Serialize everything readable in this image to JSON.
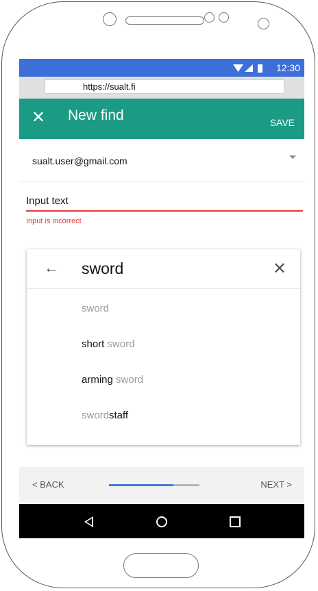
{
  "status_bar": {
    "time": "12:30",
    "icons": [
      "wifi-icon",
      "signal-icon",
      "battery-icon"
    ],
    "color": "#3d6fd9"
  },
  "browser": {
    "url": "https://sualt.fi"
  },
  "app_bar": {
    "title": "New find",
    "close_icon": "close-icon",
    "save_label": "SAVE",
    "color": "#1b9a84"
  },
  "account": {
    "email": "sualt.user@gmail.com",
    "dropdown_icon": "caret-down-icon"
  },
  "input": {
    "label": "Input text",
    "error": "Input is incorrect",
    "error_color": "#e53935"
  },
  "search": {
    "query": "sword",
    "back_icon": "arrow-left-icon",
    "clear_icon": "close-icon",
    "suggestions": [
      {
        "bold": "",
        "muted": "sword"
      },
      {
        "bold": "short",
        "muted": " sword"
      },
      {
        "bold": "arming",
        "muted": " sword"
      },
      {
        "muted": "sword",
        "bold": "staff"
      }
    ]
  },
  "footer": {
    "back_label": "< BACK",
    "next_label": "NEXT >",
    "progress": 0.71,
    "progress_color": "#3f7bd8"
  },
  "nav": {
    "icons": [
      "nav-back-icon",
      "nav-home-icon",
      "nav-recents-icon"
    ]
  }
}
